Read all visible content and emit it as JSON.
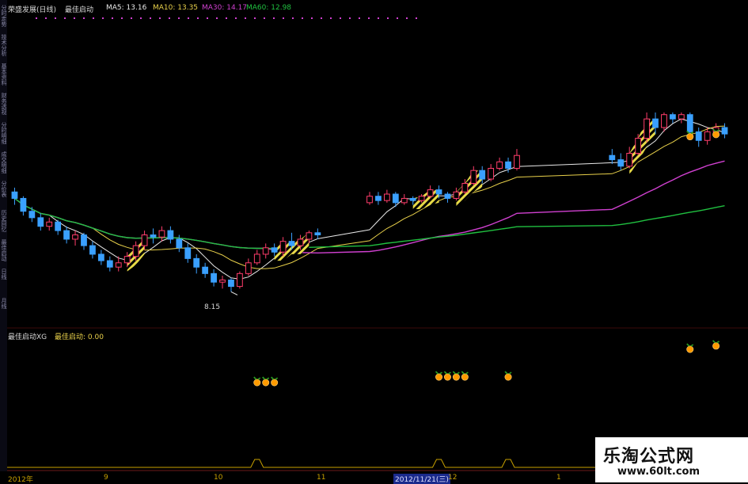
{
  "header": {
    "stock": "荣盛发展(日线)",
    "indicator": "最佳启动",
    "ma5": "MA5: 13.16",
    "ma10": "MA10: 13.35",
    "ma30": "MA30: 14.17",
    "ma60": "MA60: 12.98"
  },
  "indicator_panel": {
    "title": "最佳启动XG",
    "value_label": "最佳启动: 0.00"
  },
  "sidebar_tabs": [
    "分时走势",
    "技术分析",
    "基本资料",
    "财务透视",
    "分时明细",
    "成交明细",
    "分价表",
    "历史回忆",
    "最佳启动",
    "日线",
    "月线"
  ],
  "low_label": "8.15",
  "x_axis": {
    "ticks": [
      "2012年",
      "9",
      "10",
      "11",
      "2012/11/21(三)",
      "12",
      "1"
    ],
    "date_label": "2012/11/21(三)"
  },
  "watermark": {
    "name": "乐淘公式网",
    "url": "www.60lt.com"
  },
  "colors": {
    "up": "#ff3d6b",
    "down": "#3aa0ff",
    "ma5": "#e8e8e8",
    "ma10": "#e8d04a",
    "ma30": "#d040d0",
    "ma60": "#20c040",
    "signal": "#ff9a00",
    "axis_label": "#c8a000"
  },
  "chart_data": {
    "type": "candlestick",
    "price_range": [
      7.5,
      16.5
    ],
    "candles": [
      [
        12.8,
        12.5,
        13.0,
        12.2
      ],
      [
        12.5,
        11.9,
        12.6,
        11.7
      ],
      [
        11.9,
        11.6,
        12.1,
        11.4
      ],
      [
        11.6,
        11.2,
        11.8,
        11.0
      ],
      [
        11.2,
        11.4,
        11.6,
        11.0
      ],
      [
        11.4,
        11.0,
        11.5,
        10.8
      ],
      [
        11.0,
        10.6,
        11.2,
        10.4
      ],
      [
        10.6,
        10.8,
        11.0,
        10.3
      ],
      [
        10.8,
        10.3,
        10.9,
        10.1
      ],
      [
        10.3,
        9.9,
        10.5,
        9.7
      ],
      [
        9.9,
        9.6,
        10.1,
        9.4
      ],
      [
        9.6,
        9.3,
        9.8,
        9.1
      ],
      [
        9.3,
        9.5,
        9.8,
        9.1
      ],
      [
        9.5,
        9.8,
        10.0,
        9.3
      ],
      [
        9.8,
        10.3,
        10.5,
        9.6
      ],
      [
        10.3,
        10.8,
        11.0,
        10.1
      ],
      [
        10.8,
        10.7,
        11.1,
        10.4
      ],
      [
        10.7,
        11.0,
        11.2,
        10.5
      ],
      [
        11.0,
        10.6,
        11.2,
        10.4
      ],
      [
        10.6,
        10.2,
        10.8,
        10.0
      ],
      [
        10.2,
        9.7,
        10.4,
        9.5
      ],
      [
        9.7,
        9.3,
        9.9,
        9.0
      ],
      [
        9.3,
        9.0,
        9.5,
        8.8
      ],
      [
        9.0,
        8.6,
        9.2,
        8.4
      ],
      [
        8.6,
        8.7,
        8.9,
        8.3
      ],
      [
        8.7,
        8.4,
        8.8,
        8.15
      ],
      [
        8.4,
        9.0,
        9.1,
        8.3
      ],
      [
        9.0,
        9.5,
        9.7,
        8.9
      ],
      [
        9.5,
        9.9,
        10.1,
        9.4
      ],
      [
        9.9,
        10.2,
        10.4,
        9.7
      ],
      [
        10.2,
        10.0,
        10.4,
        9.8
      ],
      [
        10.0,
        10.5,
        10.7,
        9.8
      ],
      [
        10.5,
        10.3,
        10.9,
        10.1
      ],
      [
        10.3,
        10.6,
        10.8,
        10.1
      ],
      [
        10.6,
        10.9,
        11.0,
        10.4
      ],
      [
        10.9,
        10.8,
        11.1,
        10.6
      ],
      [
        12.3,
        12.6,
        12.8,
        12.2
      ],
      [
        12.6,
        12.4,
        12.8,
        12.2
      ],
      [
        12.4,
        12.7,
        12.9,
        12.3
      ],
      [
        12.7,
        12.3,
        12.8,
        12.1
      ],
      [
        12.3,
        12.5,
        12.7,
        12.2
      ],
      [
        12.5,
        12.4,
        12.6,
        12.2
      ],
      [
        12.4,
        12.6,
        12.7,
        12.3
      ],
      [
        12.6,
        12.9,
        13.1,
        12.5
      ],
      [
        12.9,
        12.7,
        13.1,
        12.5
      ],
      [
        12.7,
        12.5,
        12.8,
        12.3
      ],
      [
        12.5,
        12.8,
        13.0,
        12.4
      ],
      [
        12.8,
        13.2,
        13.4,
        12.7
      ],
      [
        13.2,
        13.8,
        14.0,
        13.1
      ],
      [
        13.8,
        13.4,
        14.0,
        13.2
      ],
      [
        13.4,
        13.9,
        14.1,
        13.3
      ],
      [
        13.9,
        14.2,
        14.4,
        13.8
      ],
      [
        14.2,
        13.9,
        14.4,
        13.7
      ],
      [
        13.9,
        14.5,
        14.8,
        13.8
      ],
      [
        14.5,
        14.3,
        14.8,
        14.1
      ],
      [
        14.3,
        14.0,
        14.6,
        13.8
      ],
      [
        14.0,
        14.6,
        14.9,
        13.9
      ],
      [
        14.6,
        15.3,
        15.5,
        14.5
      ],
      [
        15.3,
        16.2,
        16.5,
        15.1
      ],
      [
        16.2,
        15.8,
        16.5,
        15.5
      ],
      [
        15.8,
        16.4,
        16.5,
        15.6
      ],
      [
        16.4,
        16.2,
        16.5,
        16.0
      ],
      [
        16.2,
        16.4,
        16.5,
        16.0
      ],
      [
        16.4,
        15.6,
        16.5,
        15.3
      ],
      [
        15.6,
        15.2,
        15.8,
        14.9
      ],
      [
        15.2,
        15.6,
        15.8,
        15.0
      ],
      [
        15.6,
        15.8,
        16.0,
        15.4
      ],
      [
        15.8,
        15.5,
        16.0,
        15.3
      ]
    ],
    "gap_after_index": 35,
    "gap_days": 5,
    "jump_after_index": 53,
    "jump_days": 10,
    "hatched_ranges": [
      [
        13,
        15
      ],
      [
        30,
        34
      ],
      [
        41,
        44
      ],
      [
        46,
        49
      ],
      [
        56,
        59
      ]
    ],
    "signal_indices": [
      28,
      29,
      30,
      44,
      45,
      46,
      47,
      52,
      63,
      66
    ],
    "signal_levels": [
      0.55,
      0.55,
      0.55,
      0.6,
      0.6,
      0.6,
      0.6,
      0.6,
      0.85,
      0.88
    ],
    "low_point": {
      "index": 25,
      "value": 8.15
    }
  }
}
